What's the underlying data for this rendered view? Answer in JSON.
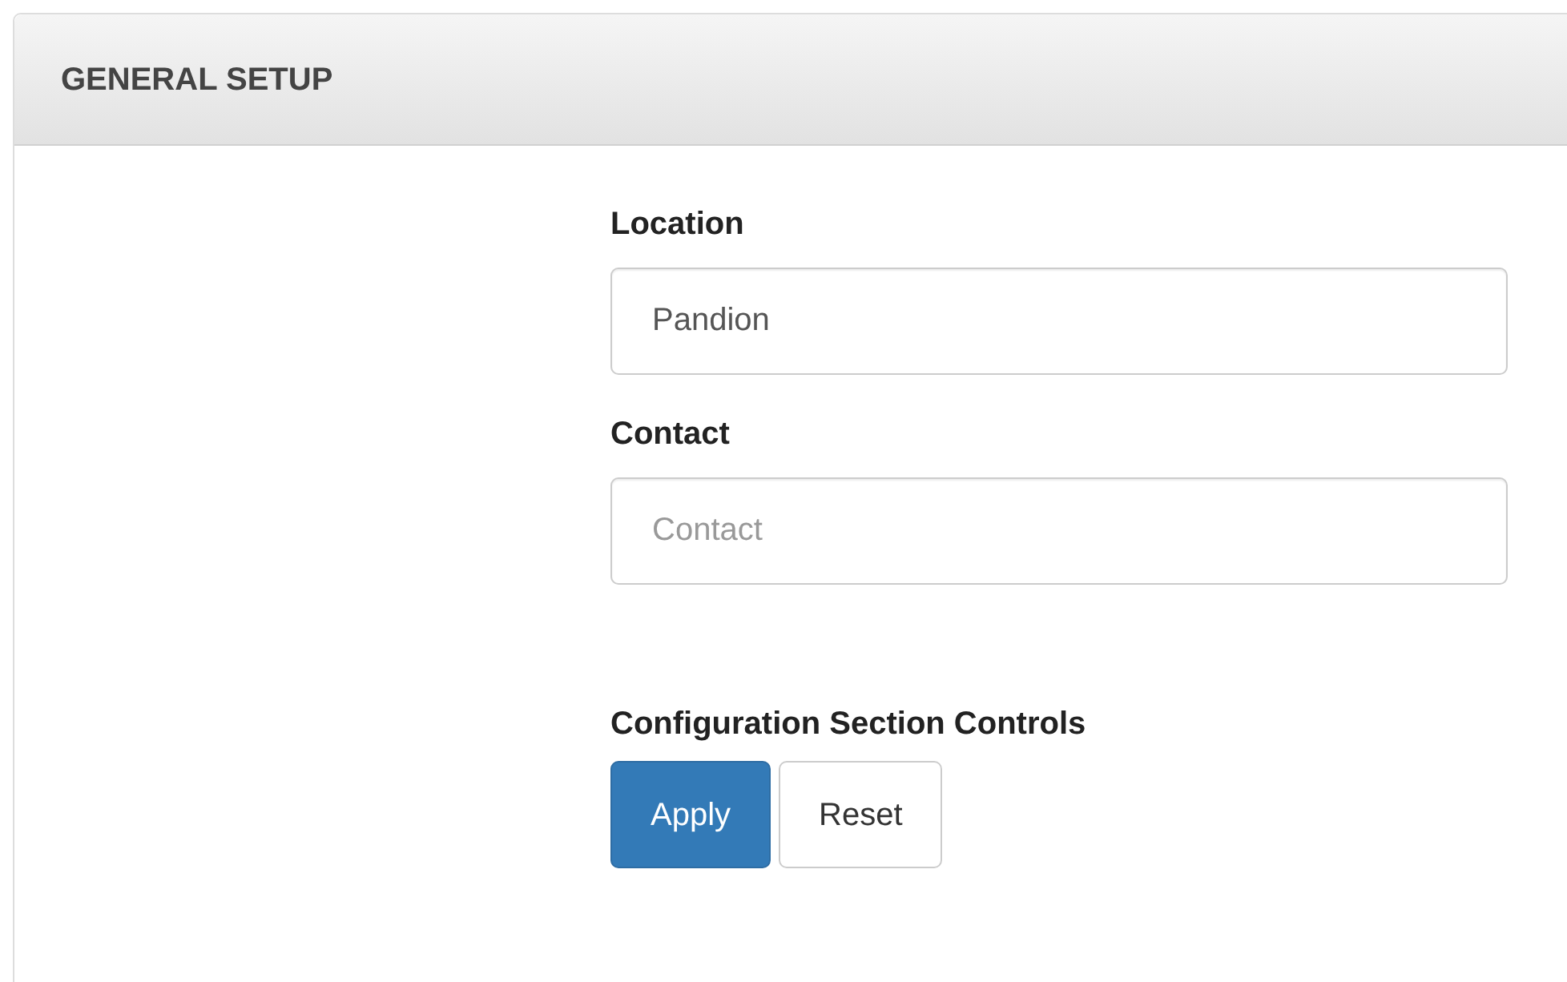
{
  "panel": {
    "title": "GENERAL SETUP"
  },
  "fields": [
    {
      "label": "Location",
      "value": "Pandion"
    },
    {
      "label": "Contact",
      "placeholder": "Contact"
    }
  ],
  "controls": {
    "label": "Configuration Section Controls",
    "buttons": [
      {
        "label": "Apply",
        "kind": "primary"
      },
      {
        "label": "Reset",
        "kind": "default"
      }
    ]
  }
}
